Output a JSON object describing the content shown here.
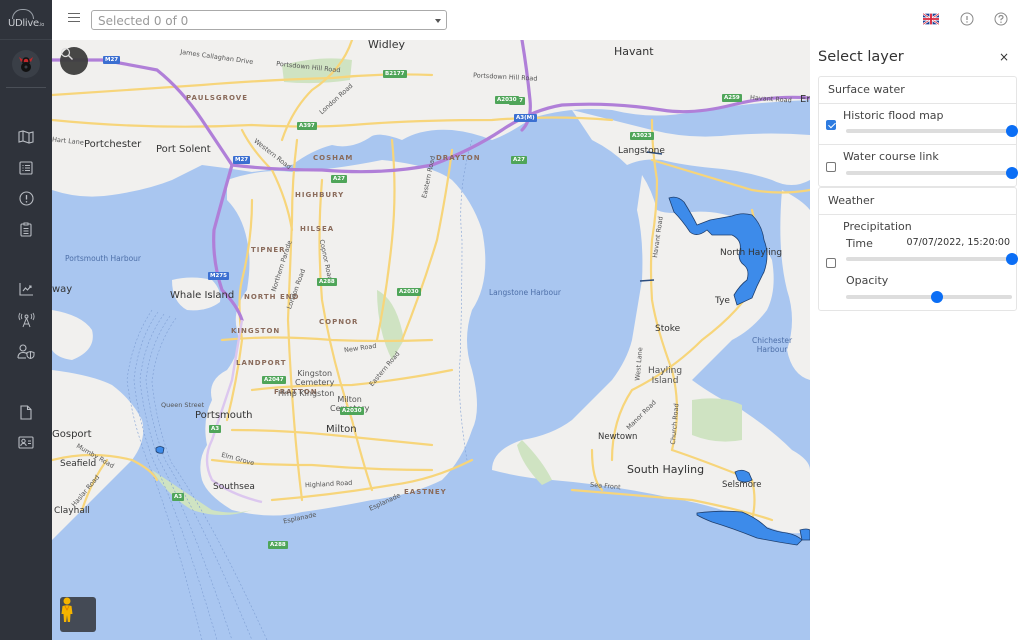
{
  "app": {
    "logo_text": "UDlive",
    "logo_suffix": ".io"
  },
  "sidebar": {
    "items": [
      {
        "name": "map",
        "icon": "map-icon"
      },
      {
        "name": "list",
        "icon": "list-icon"
      },
      {
        "name": "alerts",
        "icon": "alert-circle-icon"
      },
      {
        "name": "reports",
        "icon": "clipboard-icon"
      },
      {
        "name": "analytics",
        "icon": "chart-icon"
      },
      {
        "name": "sensors",
        "icon": "antenna-icon"
      },
      {
        "name": "user-security",
        "icon": "user-shield-icon"
      },
      {
        "name": "documents",
        "icon": "document-icon"
      },
      {
        "name": "contacts",
        "icon": "id-card-icon"
      }
    ]
  },
  "topbar": {
    "select_value": "Selected 0 of 0",
    "language": "en-GB",
    "info_icon": "info-icon",
    "help_icon": "help-icon"
  },
  "map": {
    "labels": {
      "widley": "Widley",
      "havant": "Havant",
      "portchester": "Portchester",
      "port_solent": "Port Solent",
      "paulsgrove": "PAULSGROVE",
      "cosham": "COSHAM",
      "drayton": "DRAYTON",
      "highbury": "HIGHBURY",
      "hilsea": "HILSEA",
      "tipner": "TIPNER",
      "copnor": "COPNOR",
      "north_end": "NORTH END",
      "kingston": "KINGSTON",
      "landport": "LANDPORT",
      "fratton": "FRATTON",
      "eastney": "EASTNEY",
      "portsmouth_harbour": "Portsmouth Harbour",
      "langstone_harbour": "Langstone Harbour",
      "chichester_harbour": "Chichester\nHarbour",
      "whale_island": "Whale Island",
      "kingston_cemetery": "Kingston\nCemetery",
      "hmp_kingston": "Hmp Kingston",
      "milton_cemetery": "Milton\nCemetery",
      "portsmouth": "Portsmouth",
      "milton": "Milton",
      "gosport": "Gosport",
      "seafield": "Seafield",
      "clayhall": "Clayhall",
      "southsea": "Southsea",
      "langstone": "Langstone",
      "north_hayling": "North Hayling",
      "tye": "Tye",
      "stoke": "Stoke",
      "hayling_island": "Hayling\nIsland",
      "newtown": "Newtown",
      "south_hayling": "South Hayling",
      "selsmore": "Selsmore",
      "em": "Em",
      "way": "way"
    },
    "roads": {
      "james_callaghan": "James Callaghan Drive",
      "portsdown_hill": "Portsdown Hill Road",
      "portsdown_hill2": "Portsdown Hill Road",
      "london_road": "London Road",
      "london_road2": "London Road",
      "western_road": "Western Road",
      "northern_parade": "Northern Parade",
      "copnor_road": "Copnor Road",
      "eastern_road": "Eastern Road",
      "eastern_road2": "Eastern Road",
      "new_road": "New Road",
      "queen_street": "Queen Street",
      "elm_grove": "Elm Grove",
      "highland_road": "Highland Road",
      "esplanade": "Esplanade",
      "esplanade2": "Esplanade",
      "havant_road": "Havant Road",
      "havant_road2": "Havant Road",
      "west_lane": "West Lane",
      "manor_road": "Manor Road",
      "church_road": "Church Road",
      "sea_front": "Sea Front",
      "mumby_road": "Mumby Road",
      "haslar_road": "Haslar Road",
      "hart_lane": "Hart Lane"
    },
    "shields": {
      "m27a": "M27",
      "m27b": "M27",
      "m275": "M275",
      "a3m": "A3(M)",
      "b2177": "B2177",
      "a397": "A397",
      "a27a": "A27",
      "a27b": "A27",
      "a27c": "A27",
      "a2030a": "A2030",
      "a2030b": "A2030",
      "a2030c": "A2030",
      "a259": "A259",
      "a3023": "A3023",
      "a288a": "A288",
      "a288b": "A288",
      "a2047": "A2047",
      "a3a": "A3",
      "a3b": "A3"
    }
  },
  "layer_panel": {
    "title": "Select layer",
    "close_label": "×",
    "groups": [
      {
        "title": "Surface water",
        "layers": [
          {
            "name": "Historic flood map",
            "checked": true,
            "opacity": 1.0
          },
          {
            "name": "Water course link",
            "checked": false,
            "opacity": 1.0
          }
        ]
      },
      {
        "title": "Weather",
        "layers": [
          {
            "name": "Precipitation",
            "checked": false,
            "time_label": "Time",
            "time_value": "07/07/2022, 15:20:00",
            "time_position": 1.0,
            "opacity_label": "Opacity",
            "opacity": 0.55
          }
        ]
      }
    ]
  },
  "colors": {
    "sidebar_bg": "#2f333b",
    "water": "#a9c6f0",
    "land": "#f1f0ee",
    "flood": "#3d8bea",
    "motorway": "#b07fd8",
    "road": "#f7d57a",
    "accent": "#0b6ef5"
  }
}
